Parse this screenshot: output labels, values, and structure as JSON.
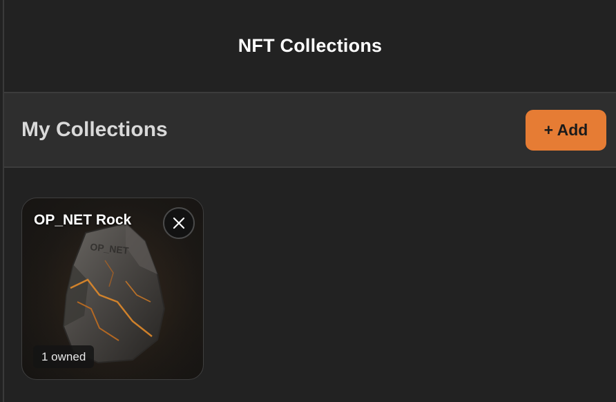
{
  "header": {
    "title": "NFT Collections"
  },
  "section": {
    "title": "My Collections",
    "add_label": "+ Add"
  },
  "collections": [
    {
      "name": "OP_NET Rock",
      "owned": "1 owned",
      "image_text": "OP_NET"
    }
  ],
  "colors": {
    "accent": "#e67c34",
    "background": "#222222",
    "section_bar": "#2e2e2e"
  },
  "icons": {
    "remove": "close-icon"
  }
}
